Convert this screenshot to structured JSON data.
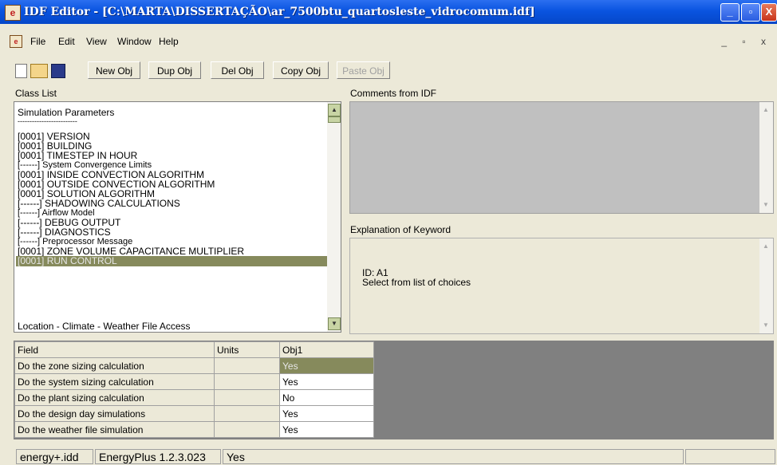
{
  "window": {
    "title": "IDF Editor - [C:\\MARTA\\DISSERTAÇÃO\\ar_7500btu_quartosleste_vidrocomum.idf]",
    "min_glyph": "_",
    "max_glyph": "▫",
    "close_glyph": "X"
  },
  "menu": {
    "items": [
      "File",
      "Edit",
      "View",
      "Window",
      "Help"
    ],
    "mdi_controls": "_ ▫ x"
  },
  "toolbar": {
    "new_obj": "New Obj",
    "dup_obj": "Dup Obj",
    "del_obj": "Del Obj",
    "copy_obj": "Copy Obj",
    "paste_obj": "Paste Obj"
  },
  "class_list": {
    "label": "Class List",
    "items": [
      "Simulation Parameters",
      "-------------------------",
      "[0001]  VERSION",
      "[0001]  BUILDING",
      "[0001]  TIMESTEP IN HOUR",
      "[------]  System Convergence Limits",
      "[0001]  INSIDE CONVECTION ALGORITHM",
      "[0001]  OUTSIDE CONVECTION ALGORITHM",
      "[0001]  SOLUTION ALGORITHM",
      "[------]  SHADOWING CALCULATIONS",
      "[------]  Airflow Model",
      "[------]  DEBUG OUTPUT",
      "[------]  DIAGNOSTICS",
      "[------]  Preprocessor Message",
      "[0001]  ZONE VOLUME CAPACITANCE MULTIPLIER",
      "[0001]  RUN CONTROL"
    ],
    "selected": "[0001]  RUN CONTROL",
    "footer_item": "Location - Climate - Weather File Access"
  },
  "comments": {
    "label": "Comments from IDF"
  },
  "explanation": {
    "label": "Explanation of Keyword",
    "text": "ID: A1\nSelect from list of choices"
  },
  "grid": {
    "headers": [
      "Field",
      "Units",
      "Obj1"
    ],
    "rows": [
      {
        "field": "Do the zone sizing calculation",
        "units": "",
        "value": "Yes"
      },
      {
        "field": "Do the system sizing calculation",
        "units": "",
        "value": "Yes"
      },
      {
        "field": "Do the plant sizing calculation",
        "units": "",
        "value": "No"
      },
      {
        "field": "Do the design day simulations",
        "units": "",
        "value": "Yes"
      },
      {
        "field": "Do the weather file simulation",
        "units": "",
        "value": "Yes"
      }
    ]
  },
  "status": {
    "idd": "energy+.idd",
    "version": "EnergyPlus 1.2.3.023",
    "value": "Yes"
  },
  "colors": {
    "selection": "#868a5c",
    "titlebar": "#0a54e0",
    "chrome": "#ece9d8"
  }
}
